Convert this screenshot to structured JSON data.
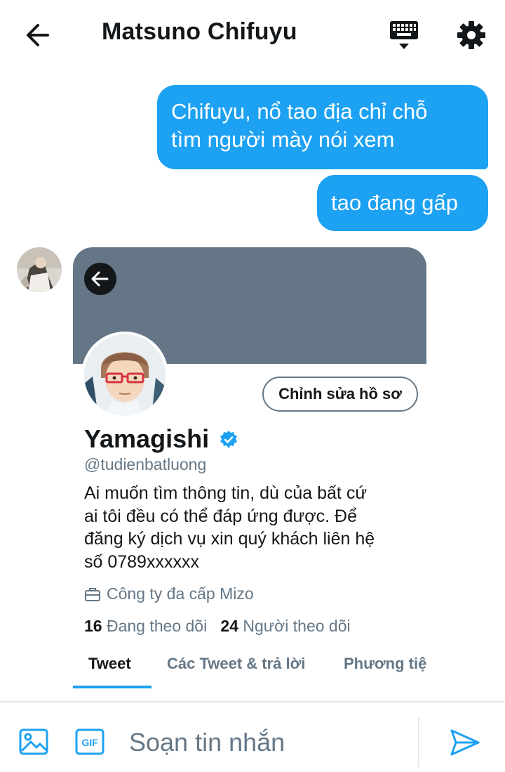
{
  "header": {
    "title": "Matsuno Chifuyu",
    "icons": [
      "back-arrow-icon",
      "keyboard-icon",
      "gear-icon"
    ]
  },
  "messages": [
    {
      "side": "sent",
      "text_lines": [
        "Chifuyu, nổ tao địa chỉ chỗ",
        "tìm người mày nói xem"
      ]
    },
    {
      "side": "sent",
      "text_lines": [
        "tao đang gấp"
      ]
    }
  ],
  "profile_card": {
    "name": "Yamagishi",
    "handle": "@tudienbatluong",
    "edit_button": "Chỉnh sửa hồ sơ",
    "bio_lines": [
      "Ai muốn tìm thông tin, dù của bất cứ",
      "ai tôi đều có thể đáp ứng được. Để",
      "đăng ký dịch vụ xin quý khách liên hệ",
      "số 0789xxxxxx"
    ],
    "company": "Công ty đa cấp Mizo",
    "following_count": "16",
    "following_label": "Đang theo dõi",
    "followers_count": "24",
    "followers_label": "Người theo dõi",
    "tabs": [
      "Tweet",
      "Các Tweet & trả lời",
      "Phương tiệ"
    ],
    "active_tab": "Tweet"
  },
  "composer": {
    "placeholder": "Soạn tin nhắn",
    "gif_label": "GIF"
  },
  "colors": {
    "accent": "#1da1f2",
    "banner": "#657786",
    "text_primary": "#14171a",
    "text_secondary": "#657786"
  }
}
